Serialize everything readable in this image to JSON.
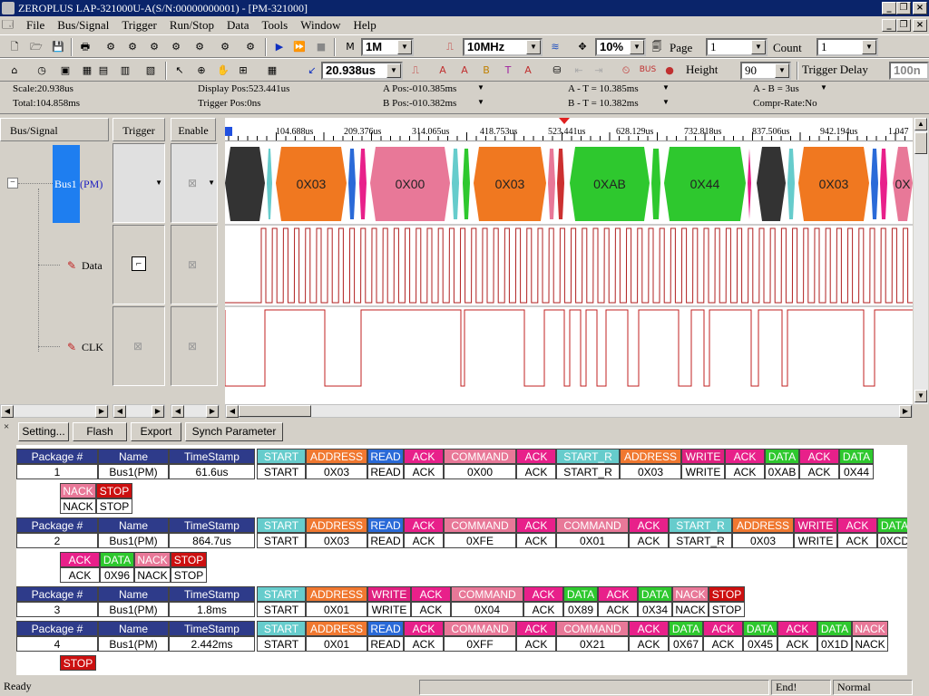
{
  "window": {
    "title": "ZEROPLUS LAP-321000U-A(S/N:00000000001) - [PM-321000]"
  },
  "menu": [
    "File",
    "Bus/Signal",
    "Trigger",
    "Run/Stop",
    "Data",
    "Tools",
    "Window",
    "Help"
  ],
  "toolbar1": {
    "sample_depth": "1M",
    "sample_rate": "10MHz",
    "trigger_pos": "10%",
    "page_label": "Page",
    "page_value": "1",
    "count_label": "Count",
    "count_value": "1"
  },
  "toolbar2": {
    "scale_value": "20.938us",
    "height_label": "Height",
    "height_value": "90",
    "trigger_delay_label": "Trigger Delay",
    "trigger_delay_value": "100n"
  },
  "info": {
    "scale": "Scale:20.938us",
    "total": "Total:104.858ms",
    "display_pos": "Display Pos:523.441us",
    "trigger_pos": "Trigger Pos:0ns",
    "a_pos": "A Pos:-010.385ms",
    "b_pos": "B Pos:-010.382ms",
    "a_t": "A - T = 10.385ms",
    "b_t": "B - T = 10.382ms",
    "a_b": "A - B = 3us",
    "compr": "Compr-Rate:No"
  },
  "signal_panel": {
    "col_bus_signal": "Bus/Signal",
    "col_trigger": "Trigger",
    "col_enable": "Enable",
    "bus_name": "Bus1",
    "bus_suffix": "(PM)",
    "data_label": "Data",
    "clk_label": "CLK"
  },
  "ruler": [
    "104.688us",
    "209.376us",
    "314.065us",
    "418.753us",
    "523.441us",
    "628.129us",
    "732.818us",
    "837.506us",
    "942.194us",
    "1.047"
  ],
  "bus_segments": [
    {
      "label": "",
      "color": "#333333"
    },
    {
      "label": "0X03",
      "color": "#f07820"
    },
    {
      "label": "0X00",
      "color": "#e87898"
    },
    {
      "label": "0X03",
      "color": "#f07820"
    },
    {
      "label": "0XAB",
      "color": "#2ec82e"
    },
    {
      "label": "0X44",
      "color": "#2ec82e"
    },
    {
      "label": "",
      "color": "#333333"
    },
    {
      "label": "0X03",
      "color": "#f07820"
    },
    {
      "label": "0X",
      "color": "#e87898"
    }
  ],
  "buttons": {
    "setting": "Setting...",
    "flash": "Flash",
    "export": "Export",
    "synch": "Synch Parameter"
  },
  "packet_headers": {
    "package": "Package #",
    "name": "Name",
    "timestamp": "TimeStamp"
  },
  "packets": [
    {
      "num": "1",
      "name": "Bus1(PM)",
      "ts": "61.6us",
      "fields": [
        [
          "START",
          "START"
        ],
        [
          "ADDRESS",
          "0X03"
        ],
        [
          "READ",
          "READ"
        ],
        [
          "ACK",
          "ACK"
        ],
        [
          "COMMAND",
          "0X00"
        ],
        [
          "ACK",
          "ACK"
        ],
        [
          "START_R",
          "START_R"
        ],
        [
          "ADDRESS",
          "0X03"
        ],
        [
          "WRITE",
          "WRITE"
        ],
        [
          "ACK",
          "ACK"
        ],
        [
          "DATA",
          "0XAB"
        ],
        [
          "ACK",
          "ACK"
        ],
        [
          "DATA",
          "0X44"
        ]
      ],
      "cont": [
        [
          "NACK",
          "NACK"
        ],
        [
          "STOP",
          "STOP"
        ]
      ]
    },
    {
      "num": "2",
      "name": "Bus1(PM)",
      "ts": "864.7us",
      "fields": [
        [
          "START",
          "START"
        ],
        [
          "ADDRESS",
          "0X03"
        ],
        [
          "READ",
          "READ"
        ],
        [
          "ACK",
          "ACK"
        ],
        [
          "COMMAND",
          "0XFE"
        ],
        [
          "ACK",
          "ACK"
        ],
        [
          "COMMAND",
          "0X01"
        ],
        [
          "ACK",
          "ACK"
        ],
        [
          "START_R",
          "START_R"
        ],
        [
          "ADDRESS",
          "0X03"
        ],
        [
          "WRITE",
          "WRITE"
        ],
        [
          "ACK",
          "ACK"
        ],
        [
          "DATA",
          "0XCD"
        ]
      ],
      "cont": [
        [
          "ACK",
          "ACK"
        ],
        [
          "DATA",
          "0X96"
        ],
        [
          "NACK",
          "NACK"
        ],
        [
          "STOP",
          "STOP"
        ]
      ]
    },
    {
      "num": "3",
      "name": "Bus1(PM)",
      "ts": "1.8ms",
      "fields": [
        [
          "START",
          "START"
        ],
        [
          "ADDRESS",
          "0X01"
        ],
        [
          "WRITE",
          "WRITE"
        ],
        [
          "ACK",
          "ACK"
        ],
        [
          "COMMAND",
          "0X04"
        ],
        [
          "ACK",
          "ACK"
        ],
        [
          "DATA",
          "0X89"
        ],
        [
          "ACK",
          "ACK"
        ],
        [
          "DATA",
          "0X34"
        ],
        [
          "NACK",
          "NACK"
        ],
        [
          "STOP",
          "STOP"
        ]
      ],
      "cont": []
    },
    {
      "num": "4",
      "name": "Bus1(PM)",
      "ts": "2.442ms",
      "fields": [
        [
          "START",
          "START"
        ],
        [
          "ADDRESS",
          "0X01"
        ],
        [
          "READ",
          "READ"
        ],
        [
          "ACK",
          "ACK"
        ],
        [
          "COMMAND",
          "0XFF"
        ],
        [
          "ACK",
          "ACK"
        ],
        [
          "COMMAND",
          "0X21"
        ],
        [
          "ACK",
          "ACK"
        ],
        [
          "DATA",
          "0X67"
        ],
        [
          "ACK",
          "ACK"
        ],
        [
          "DATA",
          "0X45"
        ],
        [
          "ACK",
          "ACK"
        ],
        [
          "DATA",
          "0X1D"
        ],
        [
          "NACK",
          "NACK"
        ]
      ],
      "cont": [
        [
          "STOP",
          ""
        ]
      ]
    }
  ],
  "colors": {
    "START": "#66cccc",
    "ADDRESS": "#f07830",
    "READ": "#2a6ad8",
    "WRITE": "#e02080",
    "ACK": "#e8208a",
    "NACK": "#e87898",
    "COMMAND": "#e87898",
    "START_R": "#66cccc",
    "DATA": "#2ec82e",
    "STOP": "#cc1010"
  },
  "status": {
    "ready": "Ready",
    "end": "End!",
    "mode": "Normal"
  }
}
